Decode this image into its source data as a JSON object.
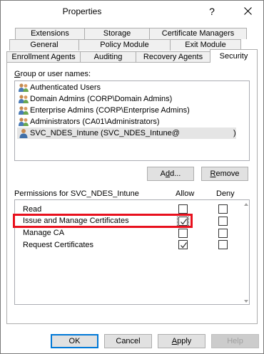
{
  "window": {
    "title": "Properties",
    "help_glyph": "?",
    "close_glyph": "✕"
  },
  "tabs": {
    "row1": [
      "Extensions",
      "Storage",
      "Certificate Managers"
    ],
    "row2": [
      "General",
      "Policy Module",
      "Exit Module"
    ],
    "row3": [
      "Enrollment Agents",
      "Auditing",
      "Recovery Agents",
      "Security"
    ]
  },
  "active_tab": "Security",
  "group_label": {
    "prefix": "",
    "accel": "G",
    "rest": "roup or user names:"
  },
  "principals": [
    {
      "name": "Authenticated Users",
      "icon": "group-icon"
    },
    {
      "name": "Domain Admins (CORP\\Domain Admins)",
      "icon": "group-icon"
    },
    {
      "name": "Enterprise Admins (CORP\\Enterprise Admins)",
      "icon": "group-icon"
    },
    {
      "name": "Administrators (CA01\\Administrators)",
      "icon": "group-icon"
    },
    {
      "name": "SVC_NDES_Intune (SVC_NDES_Intune@",
      "suffix": ")",
      "icon": "user-icon",
      "selected": true
    }
  ],
  "buttons": {
    "add": {
      "pre": "A",
      "accel": "d",
      "post": "d..."
    },
    "remove": {
      "pre": "",
      "accel": "R",
      "post": "emove"
    },
    "ok": "OK",
    "cancel": "Cancel",
    "apply": {
      "pre": "",
      "accel": "A",
      "post": "pply"
    },
    "help": "Help"
  },
  "permissions_header": {
    "label": "Permissions for SVC_NDES_Intune",
    "allow": "Allow",
    "deny": "Deny"
  },
  "permissions": [
    {
      "name": "Read",
      "allow": false,
      "deny": false
    },
    {
      "name": "Issue and Manage Certificates",
      "allow": true,
      "deny": false
    },
    {
      "name": "Manage CA",
      "allow": false,
      "deny": false
    },
    {
      "name": "Request Certificates",
      "allow": true,
      "deny": false
    }
  ],
  "colors": {
    "highlight": "#e8101d",
    "accent": "#0078d7"
  }
}
